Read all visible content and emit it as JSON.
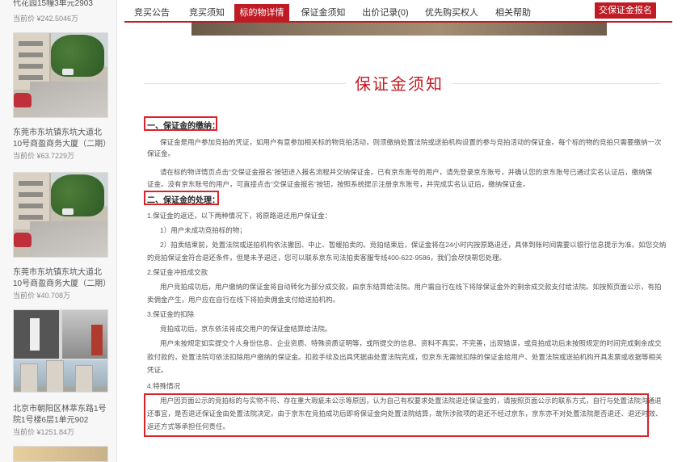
{
  "sidebar": {
    "items": [
      {
        "name": "代花园15幢3单元2903",
        "price": "当前价 ¥242.5046万"
      },
      {
        "name": "东莞市东坑镇东坑大道北10号商盈商务大厦（二期）3幢商业,",
        "price": "当前价 ¥63.7229万"
      },
      {
        "name": "东莞市东坑镇东坑大道北10号商盈商务大厦（二期）3幢商业,",
        "price": "当前价 ¥40.708万"
      },
      {
        "name": "北京市朝阳区林萃东路1号院1号楼6层1单元902（201.46㎡）",
        "price": "当前价 ¥1251.84万"
      }
    ]
  },
  "nav": {
    "tabs": [
      "竞买公告",
      "竞买须知",
      "标的物详情",
      "保证金须知",
      "出价记录(0)",
      "优先购买权人",
      "相关帮助"
    ],
    "active_tab": "标的物详情",
    "cta": "交保证金报名"
  },
  "content": {
    "title": "保证金须知",
    "section1_head": "一、保证金的缴纳：",
    "s1_p1_l1": "保证金是用户参加竞拍的凭证，如用户有意参加相关标的物竞拍活动，则须缴纳处置法院或送拍机构设置的参与竞拍活动的保证金。每个标的物的竞拍只需要缴纳一次",
    "s1_p1_l2": "保证金。",
    "s1_p2_l1": "请在标的物详情页点击“交保证金报名”按钮进入报名流程并交纳保证金。已有京东账号的用户，请先登录京东账号，并确认您的京东账号已通过实名认证后，缴纳保",
    "s1_p2_l2": "证金。没有京东账号的用户，可直接点击“交保证金报名”按钮，按照系统提示注册京东账号，并完成实名认证后，缴纳保证金。",
    "section2_head": "二、保证金的处理：",
    "s2_1": "1.保证金的返还，以下两种情况下，将原路退还用户保证金：",
    "s2_1a": "1）用户未成功竞拍标的物；",
    "s2_1b_l1": "2）拍卖结束前，处置法院或送拍机构依法撤回、中止、暂缓拍卖的。竞拍结束后，保证金将在24小时内按原路退还，具体到账时间需要以银行信息提示为准。如您交纳",
    "s2_1b_l2": "的竞拍保证金符合退还条件，但是未予退还，您可以联系京东司法拍卖客服专线400-622-9586，我们会尽快帮您处理。",
    "s2_2": "2.保证金冲抵成交款",
    "s2_2_l1": "用户竞拍成功后，用户缴纳的保证金将自动转化为部分成交款，由京东结算给法院。用户需自行在线下将除保证金外的剩余成交款支付给法院。如按照页面公示，有拍",
    "s2_2_l2": "卖佣金产生，用户应在自行在线下将拍卖佣金支付给送拍机构。",
    "s2_3": "3.保证金的扣除",
    "s2_3_l1": "竞拍成功后，京东依法将成交用户的保证金结算给法院。",
    "s2_3_l2": "用户未按规定如实提交个人身份信息、企业资质、特殊资质证明等，或所提交的信息、资料不真实，不完善，出现错误，或竞拍成功后未按照规定的时间完成剩余成交",
    "s2_3_l3": "款付款的，处置法院可依法扣除用户缴纳的保证金。扣款手续及出具凭据由处置法院完成，但京东无需就扣除的保证金给用户、处置法院或送拍机构开具发票或收据等相关",
    "s2_3_l4": "凭证。",
    "s2_4": "4.特殊情况",
    "s2_4_l1": "用户因页面公示的竞拍标的与实物不符、存在重大瑕疵未公示等原因，认为自己有权要求处置法院退还保证金的，请按照页面公示的联系方式，自行与处置法院沟通退",
    "s2_4_l2": "还事宜，是否退还保证金由处置法院决定。由于京东在竞拍成功后即将保证金向处置法院结算，故所涉款项的退还不经过京东，京东亦不对处置法院是否退还、退还时效、",
    "s2_4_l3": "返还方式等承担任何责任。"
  },
  "colors": {
    "accent": "#c01b24",
    "box": "#d9232b"
  }
}
